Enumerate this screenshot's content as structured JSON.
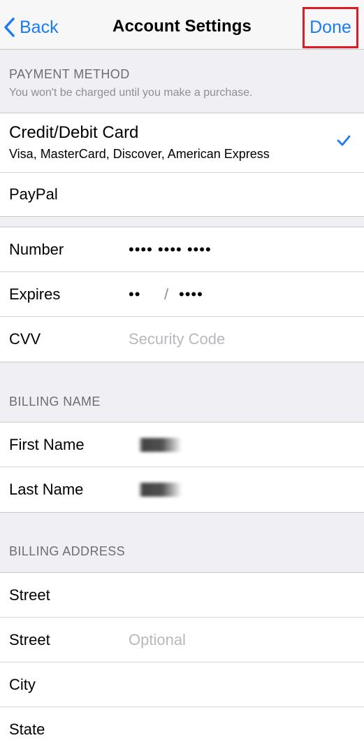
{
  "nav": {
    "back_label": "Back",
    "title": "Account Settings",
    "done_label": "Done"
  },
  "payment": {
    "header": "PAYMENT METHOD",
    "subheader": "You won't be charged until you make a purchase.",
    "options": [
      {
        "title": "Credit/Debit Card",
        "subtitle": "Visa, MasterCard, Discover, American Express",
        "selected": true
      },
      {
        "title": "PayPal",
        "selected": false
      }
    ]
  },
  "card": {
    "number_label": "Number",
    "number_value": "•••• •••• ••••",
    "expires_label": "Expires",
    "expires_month": "••",
    "expires_sep": "/",
    "expires_year": "••••",
    "cvv_label": "CVV",
    "cvv_placeholder": "Security Code"
  },
  "billing_name": {
    "header": "BILLING NAME",
    "first_label": "First Name",
    "last_label": "Last Name"
  },
  "billing_address": {
    "header": "BILLING ADDRESS",
    "street_label": "Street",
    "street2_label": "Street",
    "street2_placeholder": "Optional",
    "city_label": "City",
    "state_label": "State"
  },
  "colors": {
    "accent": "#1a7cf5",
    "highlight_box": "#e01b24"
  }
}
